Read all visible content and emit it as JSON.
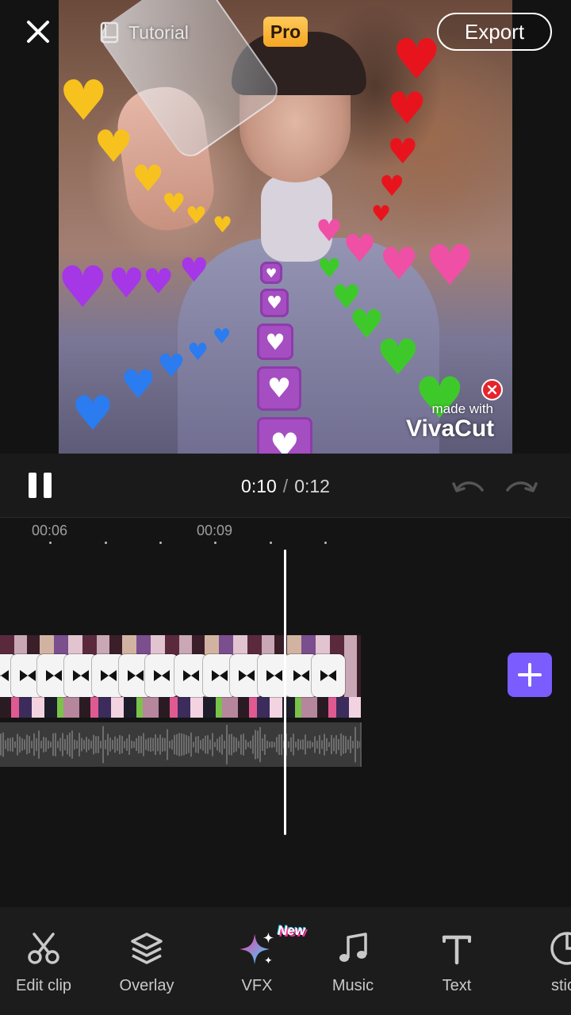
{
  "header": {
    "tutorial_label": "Tutorial",
    "pro_label": "Pro",
    "export_label": "Export"
  },
  "preview": {
    "watermark_small": "made with",
    "watermark_brand": "VivaCut"
  },
  "playback": {
    "current_time": "0:10",
    "separator": "/",
    "total_time": "0:12"
  },
  "timeline": {
    "ruler_labels": [
      "00:06",
      "00:09"
    ]
  },
  "toolbar": {
    "new_badge": "New",
    "items": [
      {
        "label": "Edit clip",
        "icon": "scissors-icon"
      },
      {
        "label": "Overlay",
        "icon": "layers-icon"
      },
      {
        "label": "VFX",
        "icon": "sparkle-icon"
      },
      {
        "label": "Music",
        "icon": "music-note-icon"
      },
      {
        "label": "Text",
        "icon": "text-icon"
      },
      {
        "label": "stick",
        "icon": "sticker-icon"
      }
    ]
  },
  "colors": {
    "accent": "#7a5cff",
    "pro_badge": "#f5a623",
    "watermark_close": "#e7242b"
  }
}
